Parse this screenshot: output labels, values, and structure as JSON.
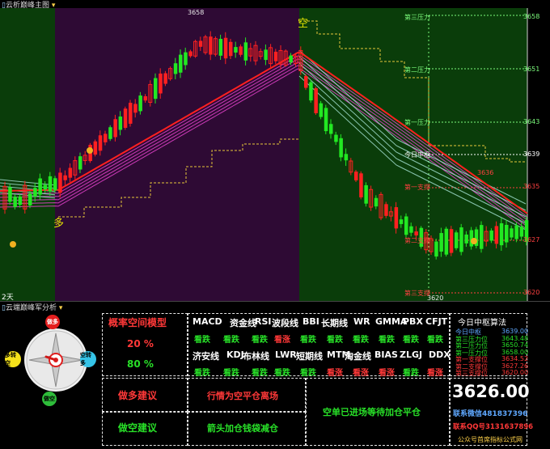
{
  "main_chart": {
    "title": "云析巅峰主图",
    "left_marker": "2天",
    "top_price": "3658",
    "kong_label": "空",
    "duo_label": "多",
    "local_high": "3636",
    "bottom_price": "3620",
    "levels": [
      {
        "name": "第三压力",
        "value": "3658",
        "color": "#7cfc7c"
      },
      {
        "name": "第二压力",
        "value": "3651",
        "color": "#7cfc7c"
      },
      {
        "name": "第一压力",
        "value": "3643",
        "color": "#7cfc7c"
      },
      {
        "name": "今日中枢",
        "value": "3639",
        "color": "#ffffff"
      },
      {
        "name": "第一支撑",
        "value": "3635",
        "color": "#ff4040"
      },
      {
        "name": "第二支撑",
        "value": "3627",
        "color": "#ff4040"
      },
      {
        "name": "第三支撑",
        "value": "3620",
        "color": "#ff4040"
      }
    ]
  },
  "analysis_panel": {
    "title": "云端巅峰军分析",
    "compass": {
      "top": "做多",
      "left": "多转空",
      "right": "空转多",
      "bottom": "做空"
    },
    "model_title": "概率空间模型",
    "probabilities": [
      "20 %",
      "80 %"
    ],
    "indicators_row1": [
      "MACD",
      "资金线",
      "RSI",
      "波段线",
      "BBI",
      "长期线",
      "WR",
      "GMMA",
      "PBX",
      "CFJT"
    ],
    "signals_row1": [
      {
        "text": "看跌",
        "dir": "up"
      },
      {
        "text": "看跌",
        "dir": "up"
      },
      {
        "text": "看跌",
        "dir": "up"
      },
      {
        "text": "看涨",
        "dir": "down"
      },
      {
        "text": "看跌",
        "dir": "up"
      },
      {
        "text": "看跌",
        "dir": "up"
      },
      {
        "text": "看跌",
        "dir": "up"
      },
      {
        "text": "看跌",
        "dir": "up"
      },
      {
        "text": "看跌",
        "dir": "up"
      },
      {
        "text": "看跌",
        "dir": "up"
      }
    ],
    "indicators_row2": [
      "济安线",
      "KDJ",
      "布林线",
      "LWR",
      "短期线",
      "MTM",
      "淘金线",
      "BIAS",
      "ZLGJ",
      "DDX"
    ],
    "signals_row2": [
      {
        "text": "看跌",
        "dir": "up"
      },
      {
        "text": "看跌",
        "dir": "up"
      },
      {
        "text": "看跌",
        "dir": "up"
      },
      {
        "text": "看跌",
        "dir": "up"
      },
      {
        "text": "看跌",
        "dir": "up"
      },
      {
        "text": "看涨",
        "dir": "down"
      },
      {
        "text": "看涨",
        "dir": "down"
      },
      {
        "text": "看涨",
        "dir": "down"
      },
      {
        "text": "看跌",
        "dir": "up"
      },
      {
        "text": "看涨",
        "dir": "down"
      }
    ],
    "pivot_title": "今日中枢算法",
    "pivot_rows": [
      {
        "name": "今日中枢",
        "value": "3639.00",
        "color": "#5fa8ff"
      },
      {
        "name": "第三压力位",
        "value": "3643.48",
        "color": "#28e028"
      },
      {
        "name": "第二压力位",
        "value": "3650.74",
        "color": "#28e028"
      },
      {
        "name": "第一压力位",
        "value": "3658.00",
        "color": "#28e028"
      },
      {
        "name": "第一支撑位",
        "value": "3634.52",
        "color": "#ff3838"
      },
      {
        "name": "第二支撑位",
        "value": "3627.26",
        "color": "#ff3838"
      },
      {
        "name": "第三支撑位",
        "value": "3620.00",
        "color": "#ff3838"
      }
    ],
    "advice_long_label": "做多建议",
    "advice_long_text": "行情为空平仓离场",
    "advice_short_label": "做空建议",
    "advice_short_text": "箭头加仓钱袋减仓",
    "short_position_text": "空单已进场等待加仓平仓",
    "current_price": "3626.00",
    "contact_wechat": "联系微信481837396",
    "contact_qq": "联系QQ号3131637896",
    "footer_text": "公众号首席指标公式网"
  }
}
